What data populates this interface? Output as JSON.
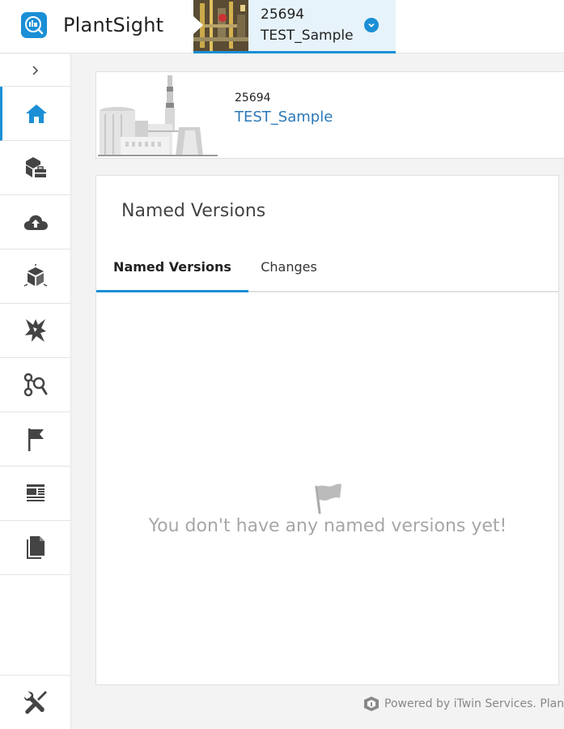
{
  "app": {
    "name": "PlantSight",
    "logo_icon": "plantsight-logo-icon"
  },
  "project_switcher": {
    "number": "25694",
    "name": "TEST_Sample"
  },
  "sidebar": {
    "toggle_icon": "chevron-right-icon",
    "items": [
      {
        "icon": "home-icon",
        "active": true
      },
      {
        "icon": "asset-toolbox-icon",
        "active": false
      },
      {
        "icon": "cloud-upload-icon",
        "active": false
      },
      {
        "icon": "3d-cube-icon",
        "active": false
      },
      {
        "icon": "clash-icon",
        "active": false
      },
      {
        "icon": "search-network-icon",
        "active": false
      },
      {
        "icon": "flag-icon",
        "active": false
      },
      {
        "icon": "reports-icon",
        "active": false
      },
      {
        "icon": "documents-icon",
        "active": false
      }
    ],
    "settings_icon": "tools-icon"
  },
  "project_card": {
    "number": "25694",
    "name": "TEST_Sample"
  },
  "panel": {
    "title": "Named Versions",
    "tabs": [
      {
        "label": "Named Versions",
        "active": true
      },
      {
        "label": "Changes",
        "active": false
      }
    ],
    "empty_message": "You don't have any named versions yet!"
  },
  "footer": {
    "text": "Powered by iTwin Services.  Plan"
  },
  "colors": {
    "accent": "#1a8fd6",
    "link": "#2b78b8",
    "icon": "#444444",
    "muted": "#a7a7a7"
  }
}
